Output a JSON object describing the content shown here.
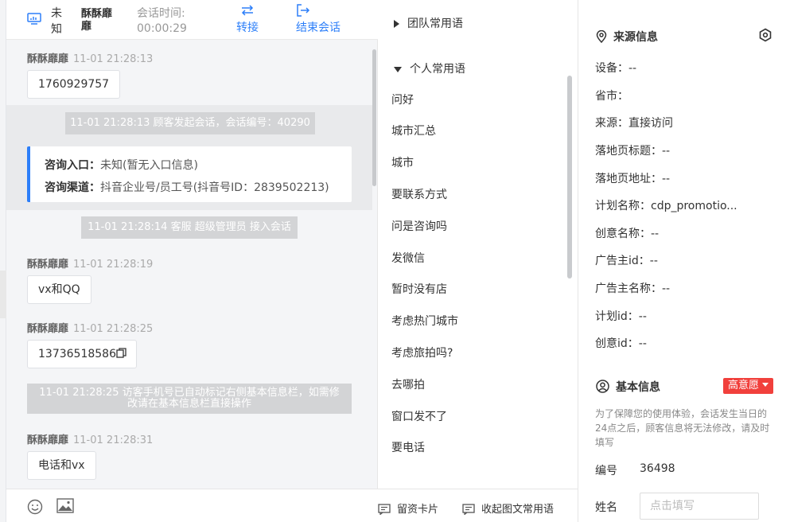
{
  "header": {
    "status": "未知",
    "customer_name": "酥酥靡靡",
    "session_time_label": "会话时间:",
    "session_time": "00:00:29",
    "transfer_label": "转接",
    "end_label": "结束会话"
  },
  "messages": [
    {
      "sender": "酥酥靡靡",
      "time": "11-01 21:28:13",
      "text": "1760929757"
    },
    {
      "sender": "酥酥靡靡",
      "time": "11-01 21:28:19",
      "text": "vx和QQ"
    },
    {
      "sender": "酥酥靡靡",
      "time": "11-01 21:28:25",
      "text": "13736518586"
    },
    {
      "sender": "酥酥靡靡",
      "time": "11-01 21:28:31",
      "text": "电话和vx"
    }
  ],
  "system": {
    "session_started": "11-01 21:28:13 顾客发起会话，会话编号：40290",
    "agent_joined": "11-01 21:28:14 客服 超级管理员 接入会话",
    "auto_mark_line1": "11-01 21:28:25 访客手机号已自动标记右侧基本信息栏，如需修",
    "auto_mark_line2": "改请在基本信息栏直接操作"
  },
  "entry": {
    "entrance_label": "咨询入口：",
    "entrance_value": "未知(暂无入口信息)",
    "channel_label": "咨询渠道：",
    "channel_value": "抖音企业号/员工号(抖音号ID：2839502213)"
  },
  "phrases": {
    "team_group": "团队常用语",
    "personal_group": "个人常用语",
    "items": [
      "问好",
      "城市汇总",
      "城市",
      "要联系方式",
      "问是咨询吗",
      "发微信",
      "暂时没有店",
      "考虑热门城市",
      "考虑旅拍吗?",
      "去哪拍",
      "窗口发不了",
      "要电话"
    ],
    "card_btn": "留资卡片",
    "collapse_btn": "收起图文常用语"
  },
  "source": {
    "title": "来源信息",
    "rows": [
      "设备：--",
      "省市：",
      "来源：直接访问",
      "落地页标题：--",
      "落地页地址：--",
      "计划名称：cdp_promotio...",
      "创意名称：--",
      "广告主id：--",
      "广告主名称：--",
      "计划id：--",
      "创意id：--"
    ]
  },
  "basic": {
    "title": "基本信息",
    "badge": "高意愿",
    "note": "为了保障您的使用体验，会话发生当日的24点之后，顾客信息将无法修改，请及时填写",
    "id_label": "编号",
    "id_value": "36498",
    "name_label": "姓名",
    "name_placeholder": "点击填写"
  },
  "colors": {
    "accent": "#2d7ff9",
    "badge": "#f1403c"
  }
}
